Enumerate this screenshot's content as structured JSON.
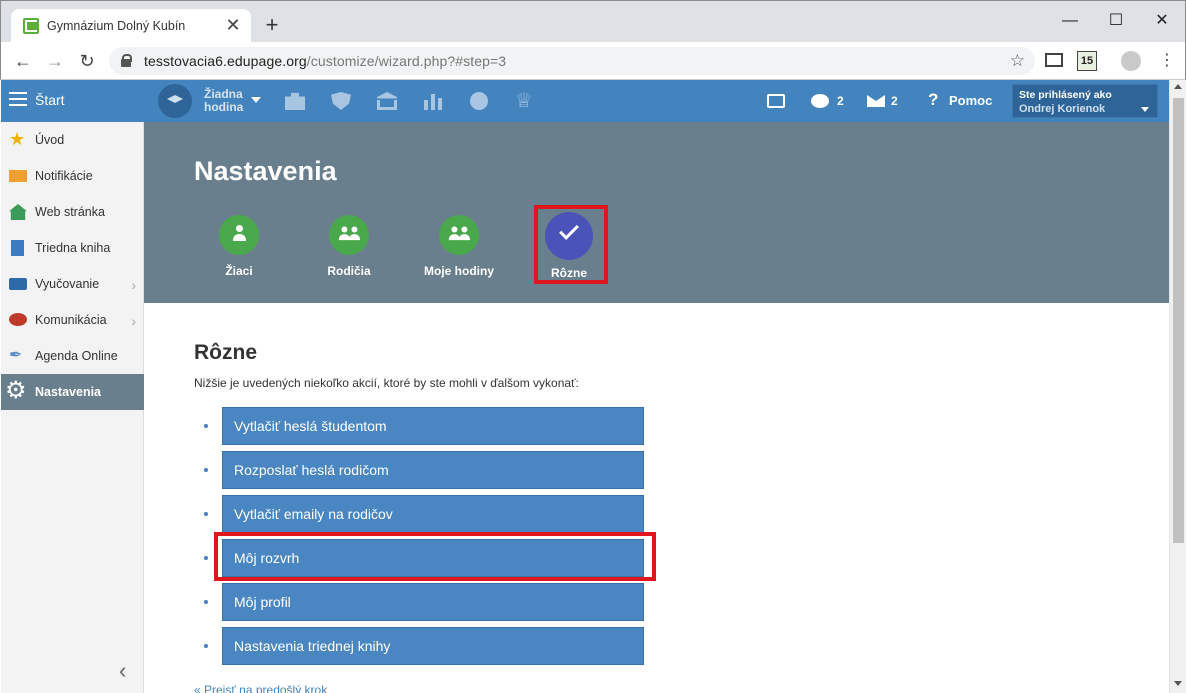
{
  "browser": {
    "tab_title": "Gymnázium Dolný Kubín",
    "url_host": "tesstovacia6.edupage.org",
    "url_path": "/customize/wizard.php?#step=3",
    "new_tab_label": "+",
    "close_label": "✕",
    "extension_badge": "15"
  },
  "topbar": {
    "start_label": "Štart",
    "lesson_label_line1": "Žiadna",
    "lesson_label_line2": "hodina",
    "chat_count": "2",
    "mail_count": "2",
    "help_label": "Pomoc",
    "user_label": "Ste prihlásený ako",
    "user_name": "Ondrej Korienok"
  },
  "sidebar": {
    "items": [
      {
        "label": "Úvod",
        "icon": "star-icon"
      },
      {
        "label": "Notifikácie",
        "icon": "mail-icon"
      },
      {
        "label": "Web stránka",
        "icon": "house-icon"
      },
      {
        "label": "Triedna kniha",
        "icon": "book-icon"
      },
      {
        "label": "Vyučovanie",
        "icon": "open-book-icon"
      },
      {
        "label": "Komunikácia",
        "icon": "chat-icon"
      },
      {
        "label": "Agenda Online",
        "icon": "pen-icon"
      },
      {
        "label": "Nastavenia",
        "icon": "gear-icon"
      }
    ]
  },
  "header": {
    "title": "Nastavenia",
    "steps": [
      {
        "label": "Žiaci"
      },
      {
        "label": "Rodičia"
      },
      {
        "label": "Moje hodiny"
      },
      {
        "label": "Rôzne"
      }
    ]
  },
  "main": {
    "section_title": "Rôzne",
    "description": "Nižšie je uvedených niekoľko akcií, ktoré by ste mohli v ďalšom vykonať:",
    "actions": [
      "Vytlačiť heslá študentom",
      "Rozposlať heslá rodičom",
      "Vytlačiť emaily na rodičov",
      "Môj rozvrh",
      "Môj profil",
      "Nastavenia triednej knihy"
    ],
    "prev_link": "« Prejsť na predošlý krok"
  },
  "colors": {
    "appbar": "#4383be",
    "header_bg": "#6a7f8e",
    "step_green": "#4aa84c",
    "step_active": "#4a54b8",
    "highlight": "#e0161f",
    "action_button": "#4a87c2"
  }
}
